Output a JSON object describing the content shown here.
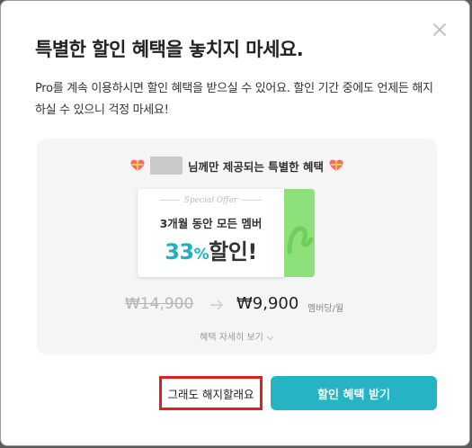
{
  "dialog": {
    "title": "특별한 할인 혜택을 놓치지 마세요.",
    "description": "Pro를 계속 이용하시면 할인 혜택을 받으실 수 있어요. 할인 기간 중에도 언제든 해지하실 수 있으니 걱정 마세요!",
    "close_icon": "close-icon"
  },
  "offer": {
    "header_suffix": "님께만 제공되는 특별한 혜택",
    "heart_icon": "heart-gift-icon",
    "ticket": {
      "badge": "Special Offer",
      "subtitle": "3개월 동안 모든 멤버",
      "percent_number": "33",
      "percent_symbol": "%",
      "discount_word": "할인!"
    },
    "old_price": "₩14,900",
    "new_price": "₩9,900",
    "unit": "멤버당/월",
    "detail_link": "혜택 자세히 보기"
  },
  "buttons": {
    "cancel": "그래도 해지할래요",
    "accept": "할인 혜택 받기"
  },
  "colors": {
    "accent": "#26b3c4",
    "ticket_green": "#8ee07a",
    "highlight_border": "#e02020"
  }
}
